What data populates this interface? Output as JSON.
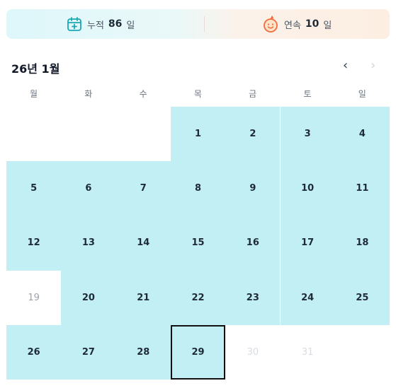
{
  "stats": {
    "cumulative": {
      "label": "누적",
      "value": "86",
      "unit": "일"
    },
    "streak": {
      "label": "연속",
      "value": "10",
      "unit": "일"
    }
  },
  "calendar": {
    "month_title": "26년 1월",
    "prev_icon": "chevron-left-icon",
    "next_icon": "chevron-right-icon",
    "weekdays": [
      "월",
      "화",
      "수",
      "목",
      "금",
      "토",
      "일"
    ],
    "colors": {
      "checked": "#c2eff4",
      "today_border": "#111111"
    },
    "days": [
      {
        "day": "1",
        "state": "checked"
      },
      {
        "day": "2",
        "state": "checked"
      },
      {
        "day": "3",
        "state": "checked"
      },
      {
        "day": "4",
        "state": "checked"
      },
      {
        "day": "5",
        "state": "checked"
      },
      {
        "day": "6",
        "state": "checked"
      },
      {
        "day": "7",
        "state": "checked"
      },
      {
        "day": "8",
        "state": "checked"
      },
      {
        "day": "9",
        "state": "checked"
      },
      {
        "day": "10",
        "state": "checked"
      },
      {
        "day": "11",
        "state": "checked"
      },
      {
        "day": "12",
        "state": "checked"
      },
      {
        "day": "13",
        "state": "checked"
      },
      {
        "day": "14",
        "state": "checked"
      },
      {
        "day": "15",
        "state": "checked"
      },
      {
        "day": "16",
        "state": "checked"
      },
      {
        "day": "17",
        "state": "checked"
      },
      {
        "day": "18",
        "state": "checked"
      },
      {
        "day": "19",
        "state": "missed"
      },
      {
        "day": "20",
        "state": "checked"
      },
      {
        "day": "21",
        "state": "checked"
      },
      {
        "day": "22",
        "state": "checked"
      },
      {
        "day": "23",
        "state": "checked"
      },
      {
        "day": "24",
        "state": "checked"
      },
      {
        "day": "25",
        "state": "checked"
      },
      {
        "day": "26",
        "state": "checked"
      },
      {
        "day": "27",
        "state": "checked"
      },
      {
        "day": "28",
        "state": "checked"
      },
      {
        "day": "29",
        "state": "today"
      },
      {
        "day": "30",
        "state": "future"
      },
      {
        "day": "31",
        "state": "future"
      }
    ]
  }
}
